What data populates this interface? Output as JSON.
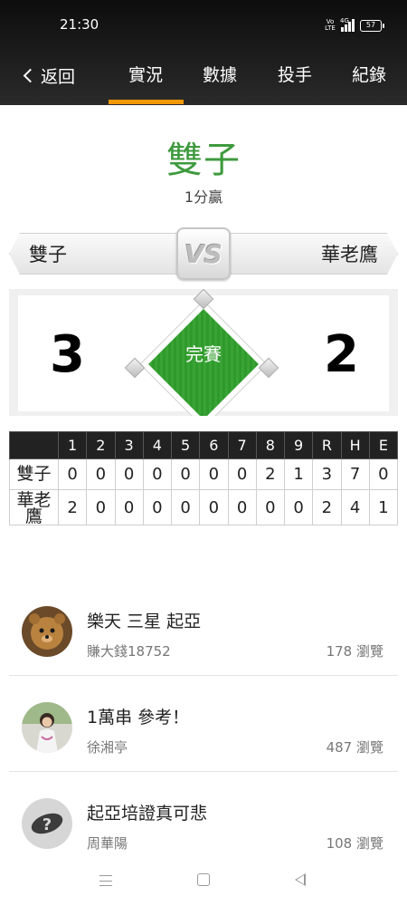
{
  "status_bar": {
    "time": "21:30",
    "volte": "Vo LTE",
    "network": "4G",
    "battery": "57"
  },
  "nav": {
    "back_label": "返回",
    "tabs": [
      {
        "label": "實況",
        "active": true
      },
      {
        "label": "數據",
        "active": false
      },
      {
        "label": "投手",
        "active": false
      },
      {
        "label": "紀錄",
        "active": false
      }
    ],
    "accent_color": "#f39800"
  },
  "game": {
    "winner": "雙子",
    "margin": "1分贏",
    "vs_label": "VS",
    "away_team": "雙子",
    "home_team": "華老鷹",
    "away_score": "3",
    "home_score": "2",
    "status": "完賽",
    "winner_color": "#3e9a3e"
  },
  "linescore": {
    "headers": [
      "1",
      "2",
      "3",
      "4",
      "5",
      "6",
      "7",
      "8",
      "9",
      "R",
      "H",
      "E"
    ],
    "rows": [
      {
        "team": "雙子",
        "values": [
          "0",
          "0",
          "0",
          "0",
          "0",
          "0",
          "0",
          "2",
          "1",
          "3",
          "7",
          "0"
        ]
      },
      {
        "team": "華老鷹",
        "values": [
          "2",
          "0",
          "0",
          "0",
          "0",
          "0",
          "0",
          "0",
          "0",
          "2",
          "4",
          "1"
        ]
      }
    ]
  },
  "comments": [
    {
      "title": "樂天 三星 起亞",
      "author": "賺大錢18752",
      "views": "178 瀏覽",
      "avatar": "teddy-bear-avatar"
    },
    {
      "title": "1萬串 參考！",
      "author": "徐湘亭",
      "views": "487 瀏覽",
      "avatar": "person-photo-avatar"
    },
    {
      "title": "起亞培證真可悲",
      "author": "周華陽",
      "views": "108 瀏覽",
      "avatar": "default-question-avatar"
    }
  ]
}
